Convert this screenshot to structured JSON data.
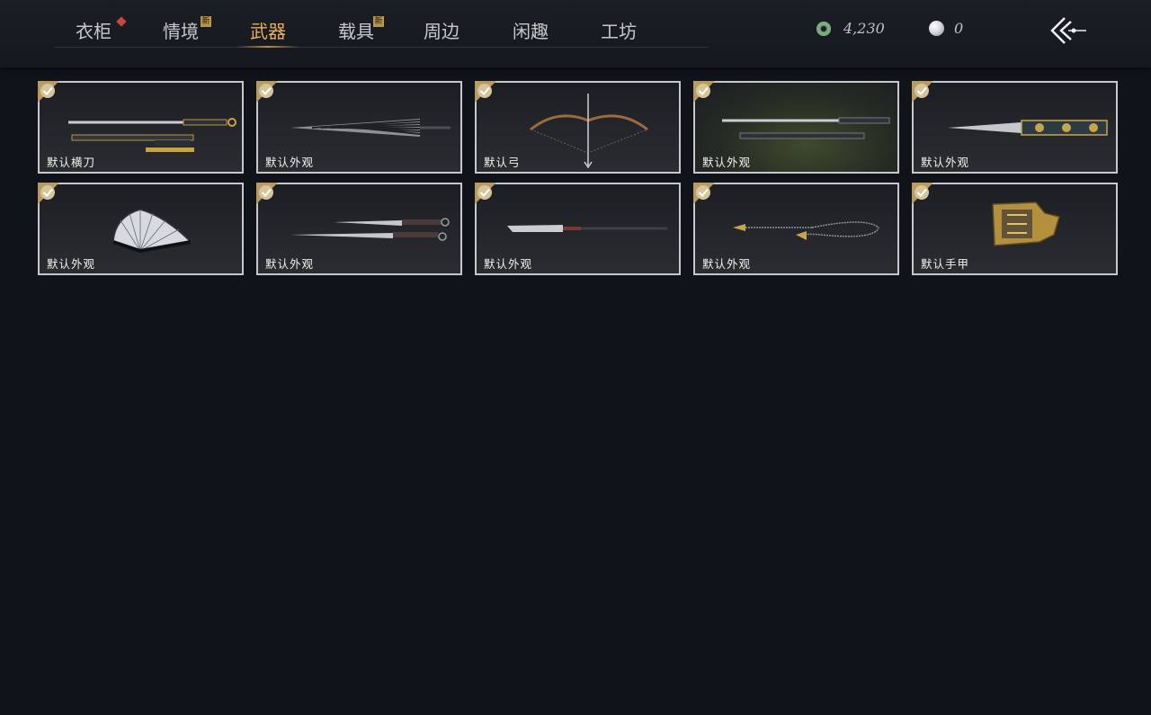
{
  "tabs": [
    {
      "label": "衣柜",
      "badge": "diamond"
    },
    {
      "label": "情境",
      "badge": "新"
    },
    {
      "label": "武器",
      "active": true
    },
    {
      "label": "载具",
      "badge": "新"
    },
    {
      "label": "周边"
    },
    {
      "label": "闲趣"
    },
    {
      "label": "工坊"
    }
  ],
  "currency": {
    "jade_amount": "4,230",
    "pearl_amount": "0"
  },
  "icons": {
    "back": "back-arrow-icon",
    "check": "check-icon"
  },
  "items": [
    {
      "label": "默认横刀",
      "art": "saber"
    },
    {
      "label": "默认外观",
      "art": "umbrella"
    },
    {
      "label": "默认弓",
      "art": "bow"
    },
    {
      "label": "默认外观",
      "art": "sword"
    },
    {
      "label": "默认外观",
      "art": "ornate-blade"
    },
    {
      "label": "默认外观",
      "art": "fan"
    },
    {
      "label": "默认外观",
      "art": "twin-blades"
    },
    {
      "label": "默认外观",
      "art": "glaive"
    },
    {
      "label": "默认外观",
      "art": "rope-dart"
    },
    {
      "label": "默认手甲",
      "art": "gauntlet"
    }
  ],
  "colors": {
    "accent": "#e6b15a",
    "card_border": "#c6c8cc",
    "check_bg": "#b99b62",
    "background": "#10131a"
  }
}
